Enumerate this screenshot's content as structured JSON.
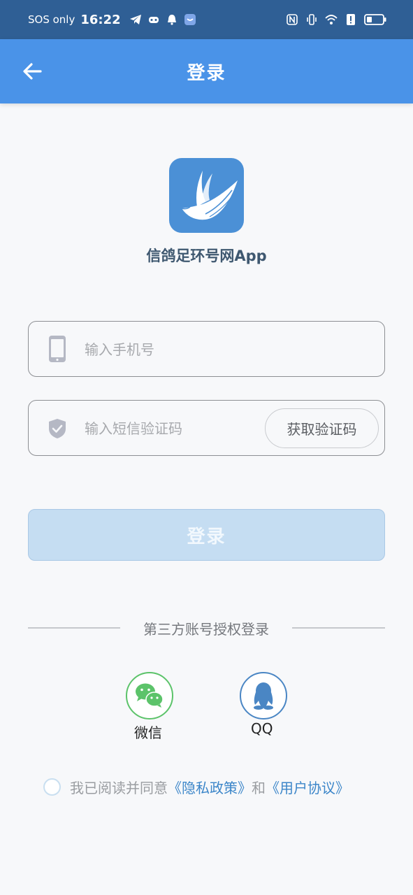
{
  "status_bar": {
    "sos": "SOS only",
    "time": "16:22"
  },
  "app_bar": {
    "title": "登录"
  },
  "logo": {
    "app_name": "信鸽足环号网App",
    "brand_color": "#4b90d6"
  },
  "form": {
    "phone_placeholder": "输入手机号",
    "code_placeholder": "输入短信验证码",
    "get_code_label": "获取验证码",
    "login_label": "登录"
  },
  "third_party": {
    "divider_text": "第三方账号授权登录",
    "wechat_label": "微信",
    "qq_label": "QQ"
  },
  "agreement": {
    "prefix": "我已阅读并同意",
    "privacy_link": "《隐私政策》",
    "and": "和",
    "terms_link": "《用户协议》"
  },
  "colors": {
    "status_bar": "#2f5f95",
    "app_bar": "#4a93e8",
    "login_disabled": "#c5ddf2",
    "link": "#3c86c9",
    "wechat": "#5cc36a",
    "qq": "#4a86c4"
  }
}
